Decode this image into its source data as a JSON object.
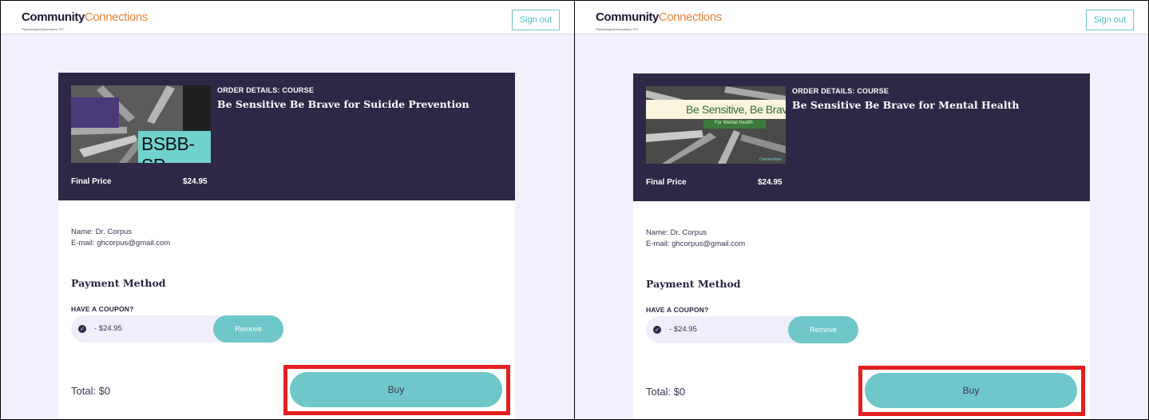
{
  "header": {
    "logo_part1": "Community",
    "logo_part2": "Connections",
    "logo_sub": "Psychological Associates, P.C.",
    "signout_label": "Sign out"
  },
  "colors": {
    "accent_teal": "#6fc7c9",
    "header_purple": "#2f2747",
    "page_bg": "#f3effd",
    "logo_orange": "#e8833a",
    "highlight_red": "#e41f1f"
  },
  "panels": [
    {
      "order_label": "ORDER DETAILS: COURSE",
      "course_title": "Be Sensitive Be Brave for Suicide Prevention",
      "thumb_text": "BSBB-SP",
      "final_price_label": "Final Price",
      "final_price": "$24.95",
      "name_line": "Name: Dr. Corpus",
      "email_line": "E-mail: ghcorpus@gmail.com",
      "payment_title": "Payment Method",
      "coupon_label": "HAVE A COUPON?",
      "discount": "- $24.95",
      "remove_label": "Remove",
      "total": "Total: $0",
      "buy_label": "Buy"
    },
    {
      "order_label": "ORDER DETAILS: COURSE",
      "course_title": "Be Sensitive Be Brave for Mental Health",
      "thumb_text": "Be Sensitive, Be Brav",
      "thumb_subtext": "For Mental Health",
      "thumb_corner": "Connections",
      "final_price_label": "Final Price",
      "final_price": "$24.95",
      "name_line": "Name: Dr. Corpus",
      "email_line": "E-mail: ghcorpus@gmail.com",
      "payment_title": "Payment Method",
      "coupon_label": "HAVE A COUPON?",
      "discount": "- $24.95",
      "remove_label": "Remove",
      "total": "Total: $0",
      "buy_label": "Buy"
    }
  ]
}
